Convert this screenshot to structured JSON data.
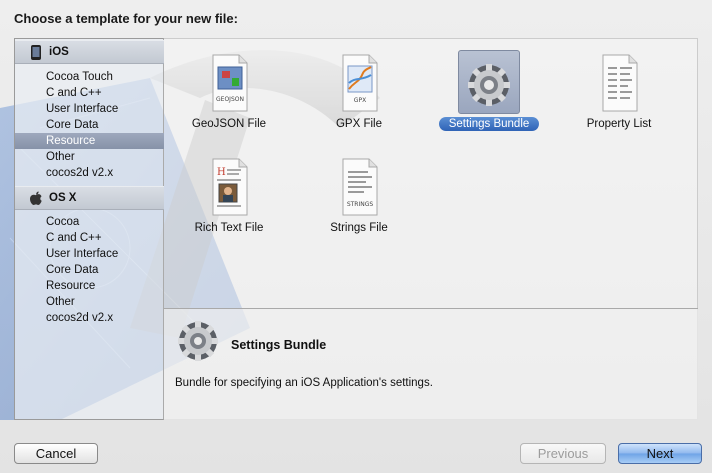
{
  "sheet": {
    "title": "Choose a template for your new file:"
  },
  "sidebar": {
    "groups": [
      {
        "label": "iOS",
        "icon": "iphone-icon",
        "items": [
          "Cocoa Touch",
          "C and C++",
          "User Interface",
          "Core Data",
          "Resource",
          "Other",
          "cocos2d v2.x"
        ],
        "selected": "Resource"
      },
      {
        "label": "OS X",
        "icon": "apple-logo-icon",
        "items": [
          "Cocoa",
          "C and C++",
          "User Interface",
          "Core Data",
          "Resource",
          "Other",
          "cocos2d v2.x"
        ]
      }
    ]
  },
  "templates": [
    {
      "label": "GeoJSON File",
      "icon": "geojson-file-icon",
      "icon_text": "GEOJSON"
    },
    {
      "label": "GPX File",
      "icon": "gpx-file-icon",
      "icon_text": "GPX"
    },
    {
      "label": "Settings Bundle",
      "icon": "settings-bundle-icon",
      "selected": true
    },
    {
      "label": "Property List",
      "icon": "property-list-icon"
    },
    {
      "label": "Rich Text File",
      "icon": "rich-text-file-icon"
    },
    {
      "label": "Strings File",
      "icon": "strings-file-icon",
      "icon_text": "STRINGS"
    }
  ],
  "details": {
    "title": "Settings Bundle",
    "description": "Bundle for specifying an iOS Application's settings."
  },
  "buttons": {
    "cancel": "Cancel",
    "previous": "Previous",
    "next": "Next"
  },
  "colors": {
    "selection_blue": "#2f63b6",
    "sidebar_selection": "#8692a8",
    "default_button": "#6ea3e6"
  }
}
